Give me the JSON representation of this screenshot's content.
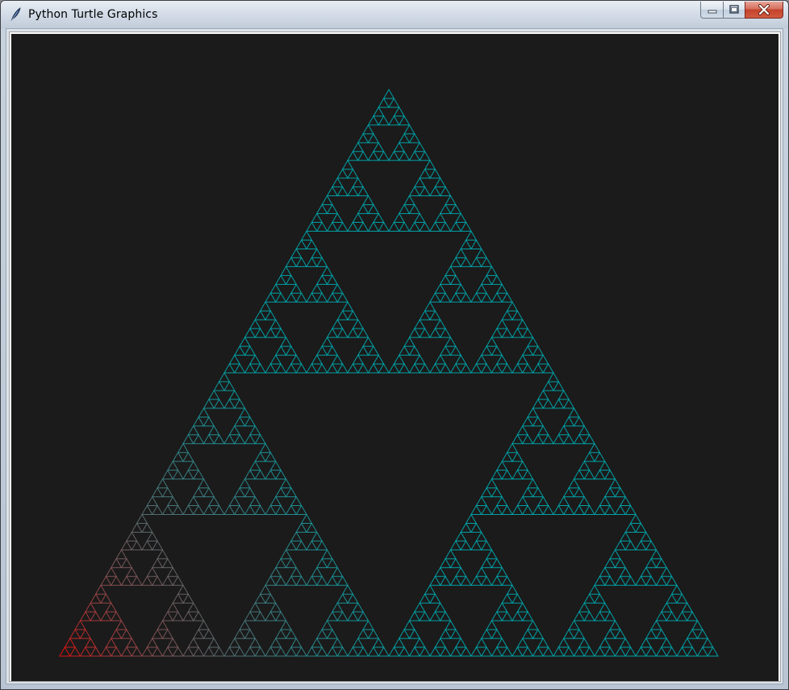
{
  "window": {
    "title": "Python Turtle Graphics",
    "icon": "feather-icon",
    "controls": [
      {
        "name": "minimize-button",
        "icon": "minimize-icon"
      },
      {
        "name": "maximize-button",
        "icon": "maximize-icon"
      },
      {
        "name": "close-button",
        "icon": "close-icon"
      }
    ]
  },
  "canvas": {
    "background": "#1b1b1b",
    "figure": "sierpinski-triangle",
    "depth": 6,
    "colors": {
      "start": "#ff0000",
      "end": "#00a0a5"
    }
  }
}
